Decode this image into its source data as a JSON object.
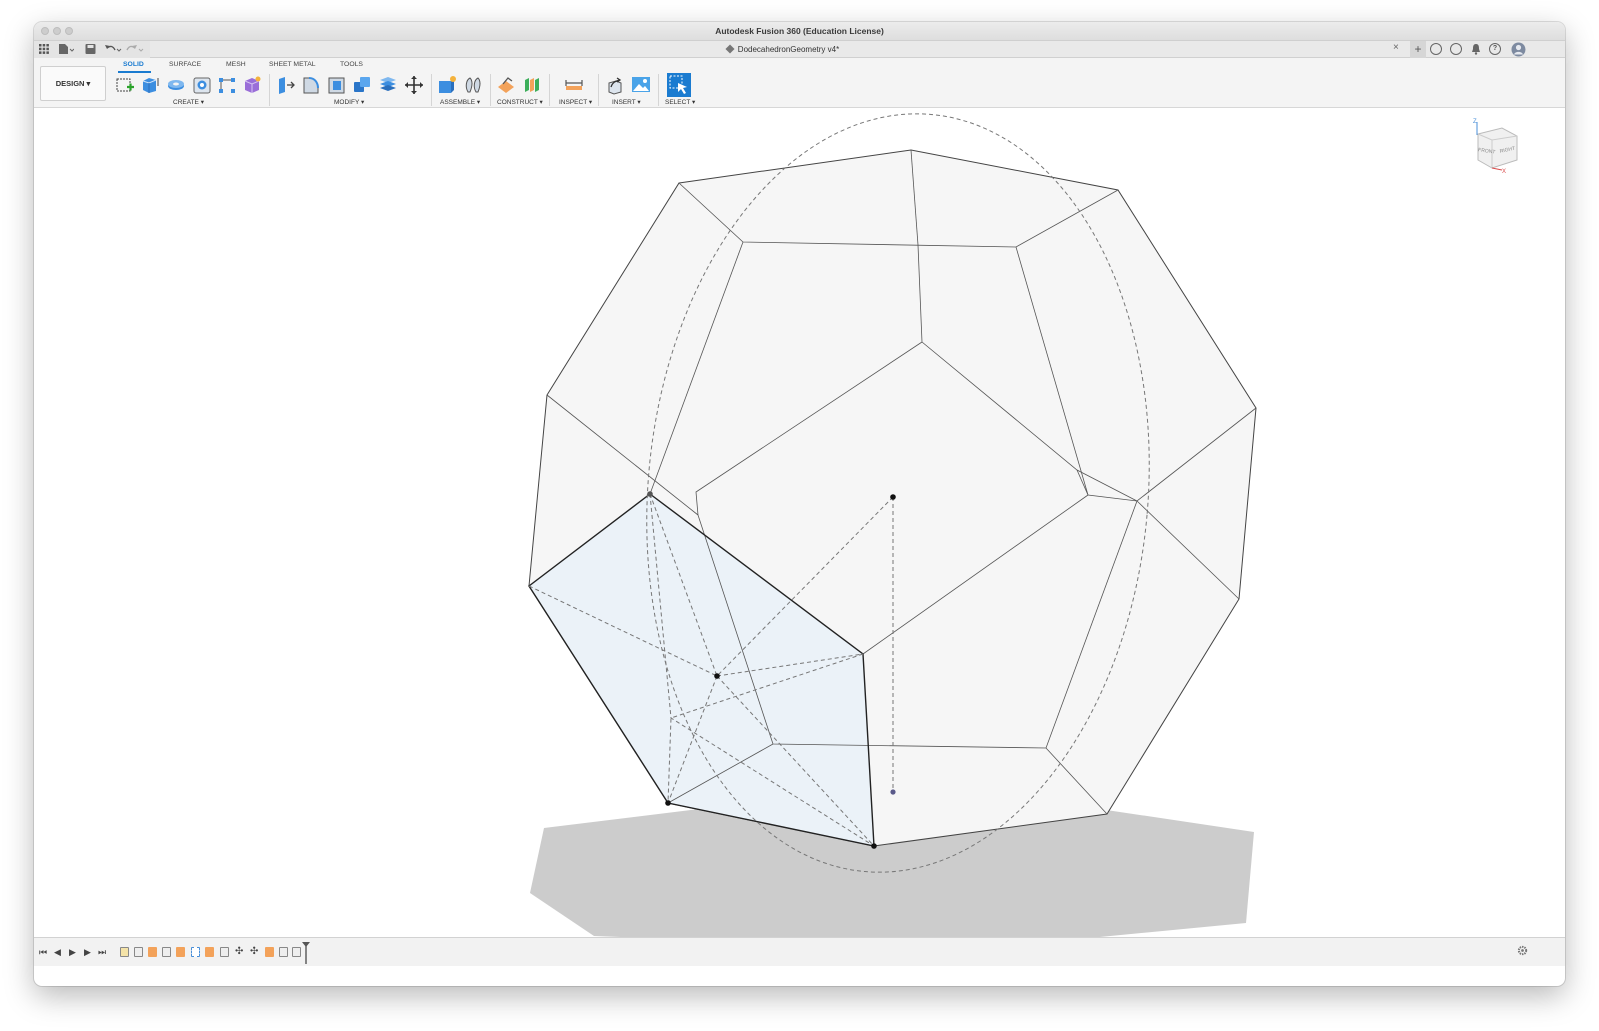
{
  "window": {
    "title": "Autodesk Fusion 360 (Education License)"
  },
  "document": {
    "tab_title": "DodecahedronGeometry v4*",
    "close_glyph": "×"
  },
  "workspace": {
    "design_label": "DESIGN ▾"
  },
  "workspace_tabs": [
    {
      "label": "SOLID",
      "active": true
    },
    {
      "label": "SURFACE",
      "active": false
    },
    {
      "label": "MESH",
      "active": false
    },
    {
      "label": "SHEET METAL",
      "active": false
    },
    {
      "label": "TOOLS",
      "active": false
    }
  ],
  "toolbar_groups": {
    "create": "CREATE ▾",
    "modify": "MODIFY ▾",
    "assemble": "ASSEMBLE ▾",
    "construct": "CONSTRUCT ▾",
    "inspect": "INSPECT ▾",
    "insert": "INSERT ▾",
    "select": "SELECT ▾"
  },
  "viewcube": {
    "front": "FRONT",
    "right": "RIGHT",
    "axis_z": "Z",
    "axis_x": "X"
  },
  "colors": {
    "accent": "#1a7bd0",
    "select_face": "#eaf2f8",
    "shadow": "#cccccc",
    "edge": "#444444",
    "timeline_feature": "#f3a25a"
  },
  "icons": {
    "grid": "grid-icon",
    "file": "file-icon",
    "save": "save-icon",
    "undo": "undo-icon",
    "redo": "redo-icon",
    "add_tab": "plus-icon",
    "online": "online-status-icon",
    "jobs": "job-status-icon",
    "notifications": "bell-icon",
    "help": "help-icon",
    "user": "user-avatar-icon",
    "settings": "gear-icon"
  },
  "timeline": {
    "first": "⏮",
    "prev": "◀",
    "play": "▶",
    "next": "▶",
    "last": "⏭"
  }
}
